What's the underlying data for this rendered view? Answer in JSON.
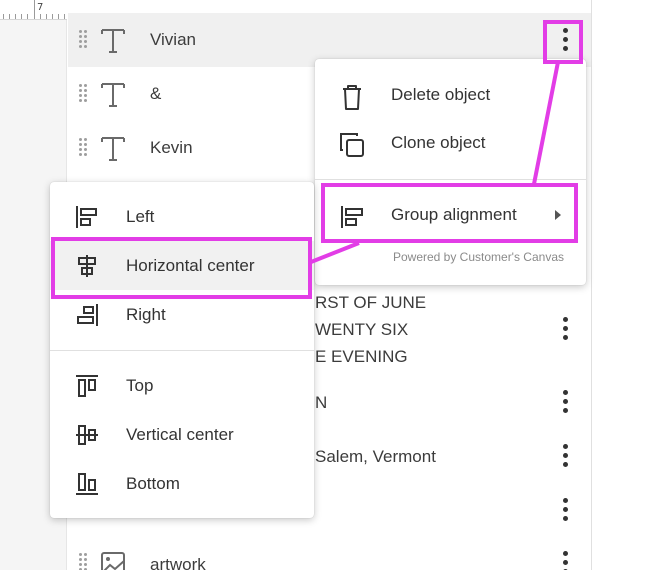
{
  "ruler": {
    "label": "7"
  },
  "layers": [
    {
      "name": "Vivian",
      "icon": "text-icon",
      "selected": true
    },
    {
      "name": "&",
      "icon": "text-icon"
    },
    {
      "name": "Kevin",
      "icon": "text-icon"
    },
    {
      "name": "artwork",
      "icon": "image-icon"
    }
  ],
  "partial_texts": {
    "line1": "RST OF JUNE",
    "line2": "WENTY SIX",
    "line3": "E EVENING",
    "line4": "N",
    "line5": "Salem, Vermont"
  },
  "context_menu": {
    "items": [
      {
        "label": "Delete object",
        "icon": "trash-icon"
      },
      {
        "label": "Clone object",
        "icon": "copy-icon"
      },
      {
        "label": "Group alignment",
        "icon": "align-left-icon",
        "has_submenu": true
      }
    ],
    "footer": "Powered by Customer's Canvas"
  },
  "alignment_menu": {
    "horizontal": [
      {
        "label": "Left",
        "icon": "align-left-icon"
      },
      {
        "label": "Horizontal center",
        "icon": "align-horizontal-center-icon",
        "highlighted": true
      },
      {
        "label": "Right",
        "icon": "align-right-icon"
      }
    ],
    "vertical": [
      {
        "label": "Top",
        "icon": "align-top-icon"
      },
      {
        "label": "Vertical center",
        "icon": "align-vertical-center-icon"
      },
      {
        "label": "Bottom",
        "icon": "align-bottom-icon"
      }
    ]
  },
  "colors": {
    "highlight": "#e23de6",
    "selected_row": "#f0f0f0",
    "menu_hover": "#f1f1f1"
  }
}
